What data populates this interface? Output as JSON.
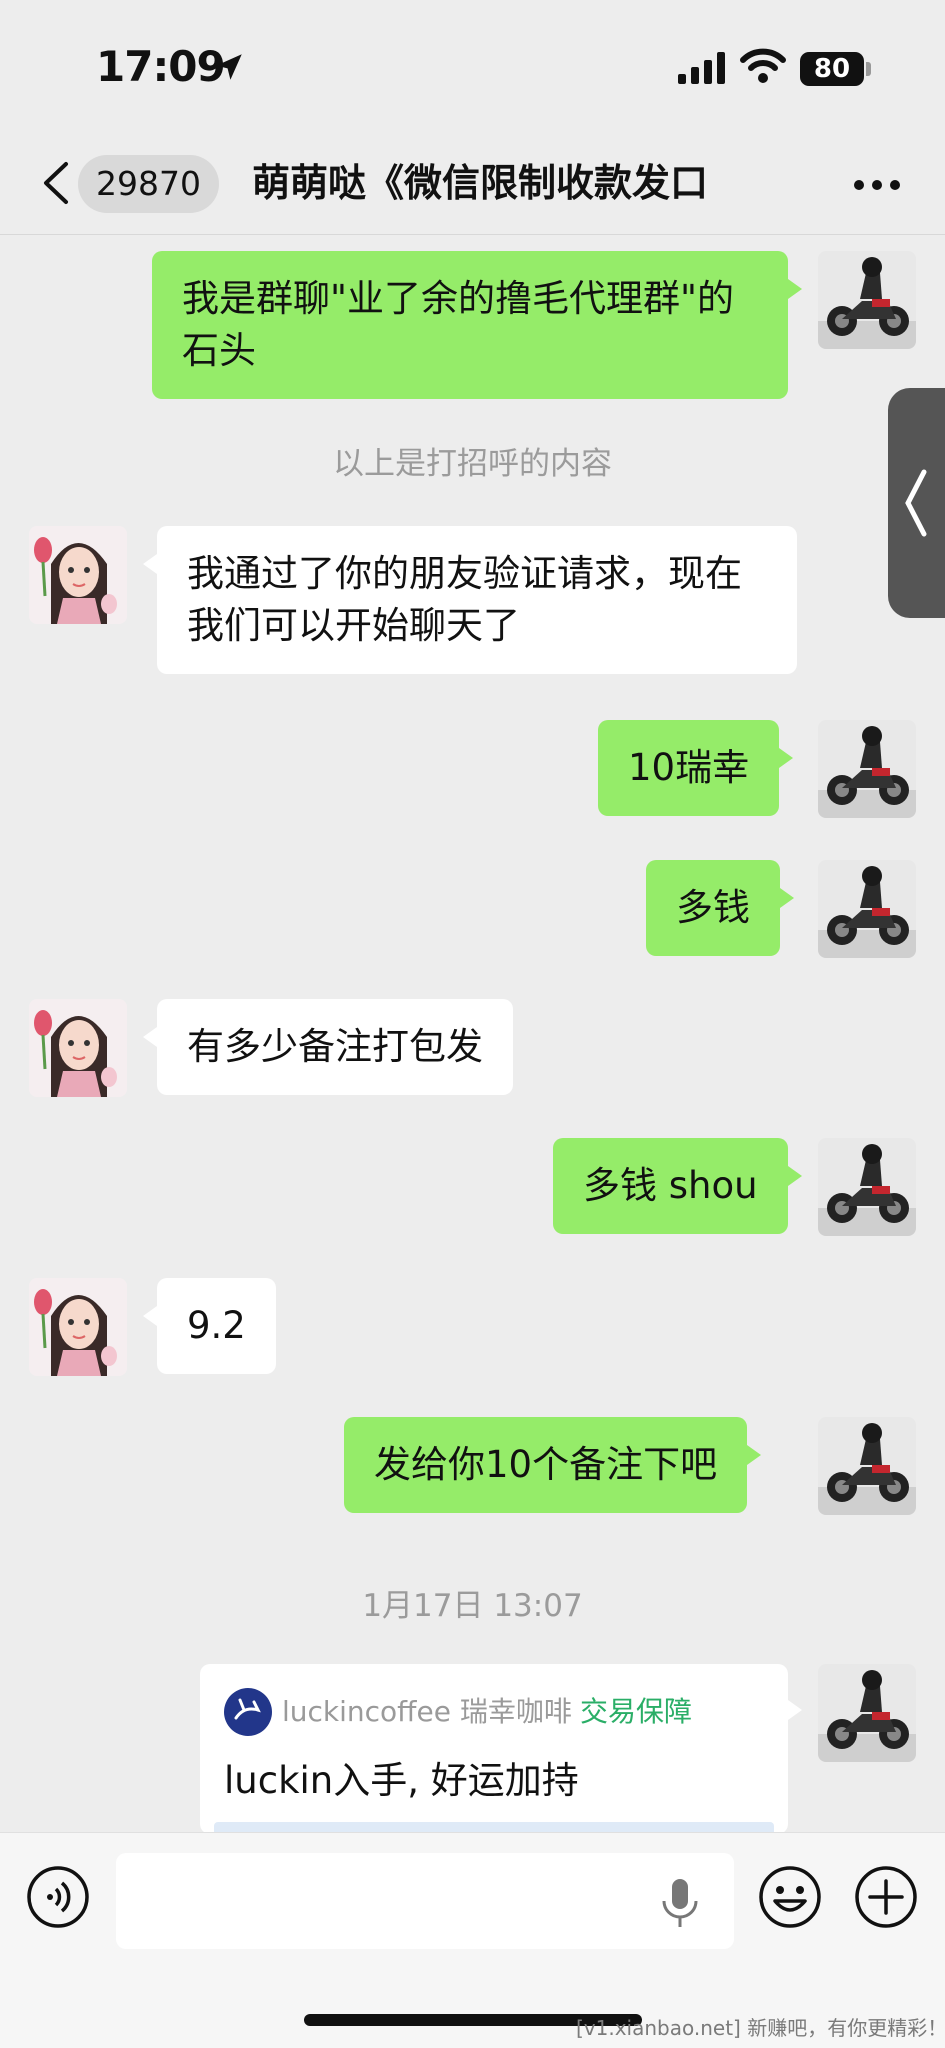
{
  "status_bar": {
    "time": "17:09",
    "battery": "80"
  },
  "nav": {
    "unread_count": "29870",
    "title": "萌萌哒《微信限制收款发口"
  },
  "messages": [
    {
      "from": "me",
      "text": "我是群聊\"业了余的撸毛代理群\"的石头"
    },
    {
      "from": "system",
      "text": "以上是打招呼的内容"
    },
    {
      "from": "her",
      "text": "我通过了你的朋友验证请求，现在我们可以开始聊天了"
    },
    {
      "from": "me",
      "text": "10瑞幸"
    },
    {
      "from": "me",
      "text": "多钱"
    },
    {
      "from": "her",
      "text": "有多少备注打包发"
    },
    {
      "from": "me",
      "text": "多钱 shou"
    },
    {
      "from": "her",
      "text": "9.2"
    },
    {
      "from": "me",
      "text": "发给你10个备注下吧"
    },
    {
      "from": "system",
      "text": "1月17日 13:07"
    }
  ],
  "link_card": {
    "source": "luckincoffee 瑞幸咖啡",
    "badge": "交易保障",
    "title": "luckin入手, 好运加持"
  },
  "input": {
    "placeholder": ""
  },
  "watermark": "[v1.xianbao.net] 新赚吧，有你更精彩！",
  "colors": {
    "my_bubble": "#95ec69",
    "her_bubble": "#ffffff",
    "background": "#ededed",
    "badge_green": "#2aae67"
  }
}
